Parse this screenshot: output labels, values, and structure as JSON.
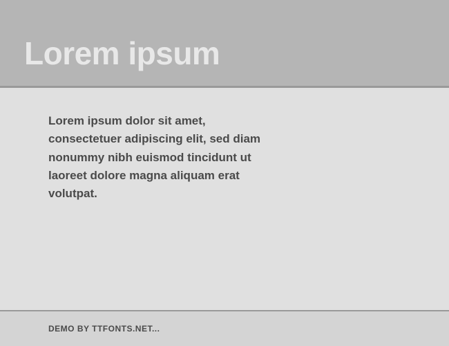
{
  "header": {
    "title": "Lorem ipsum"
  },
  "body": {
    "paragraph": "Lorem ipsum dolor sit amet, consectetuer adipiscing elit, sed diam nonummy nibh euismod tincidunt ut laoreet dolore magna aliquam erat volutpat."
  },
  "footer": {
    "text": "DEMO BY TTFONTS.NET..."
  }
}
